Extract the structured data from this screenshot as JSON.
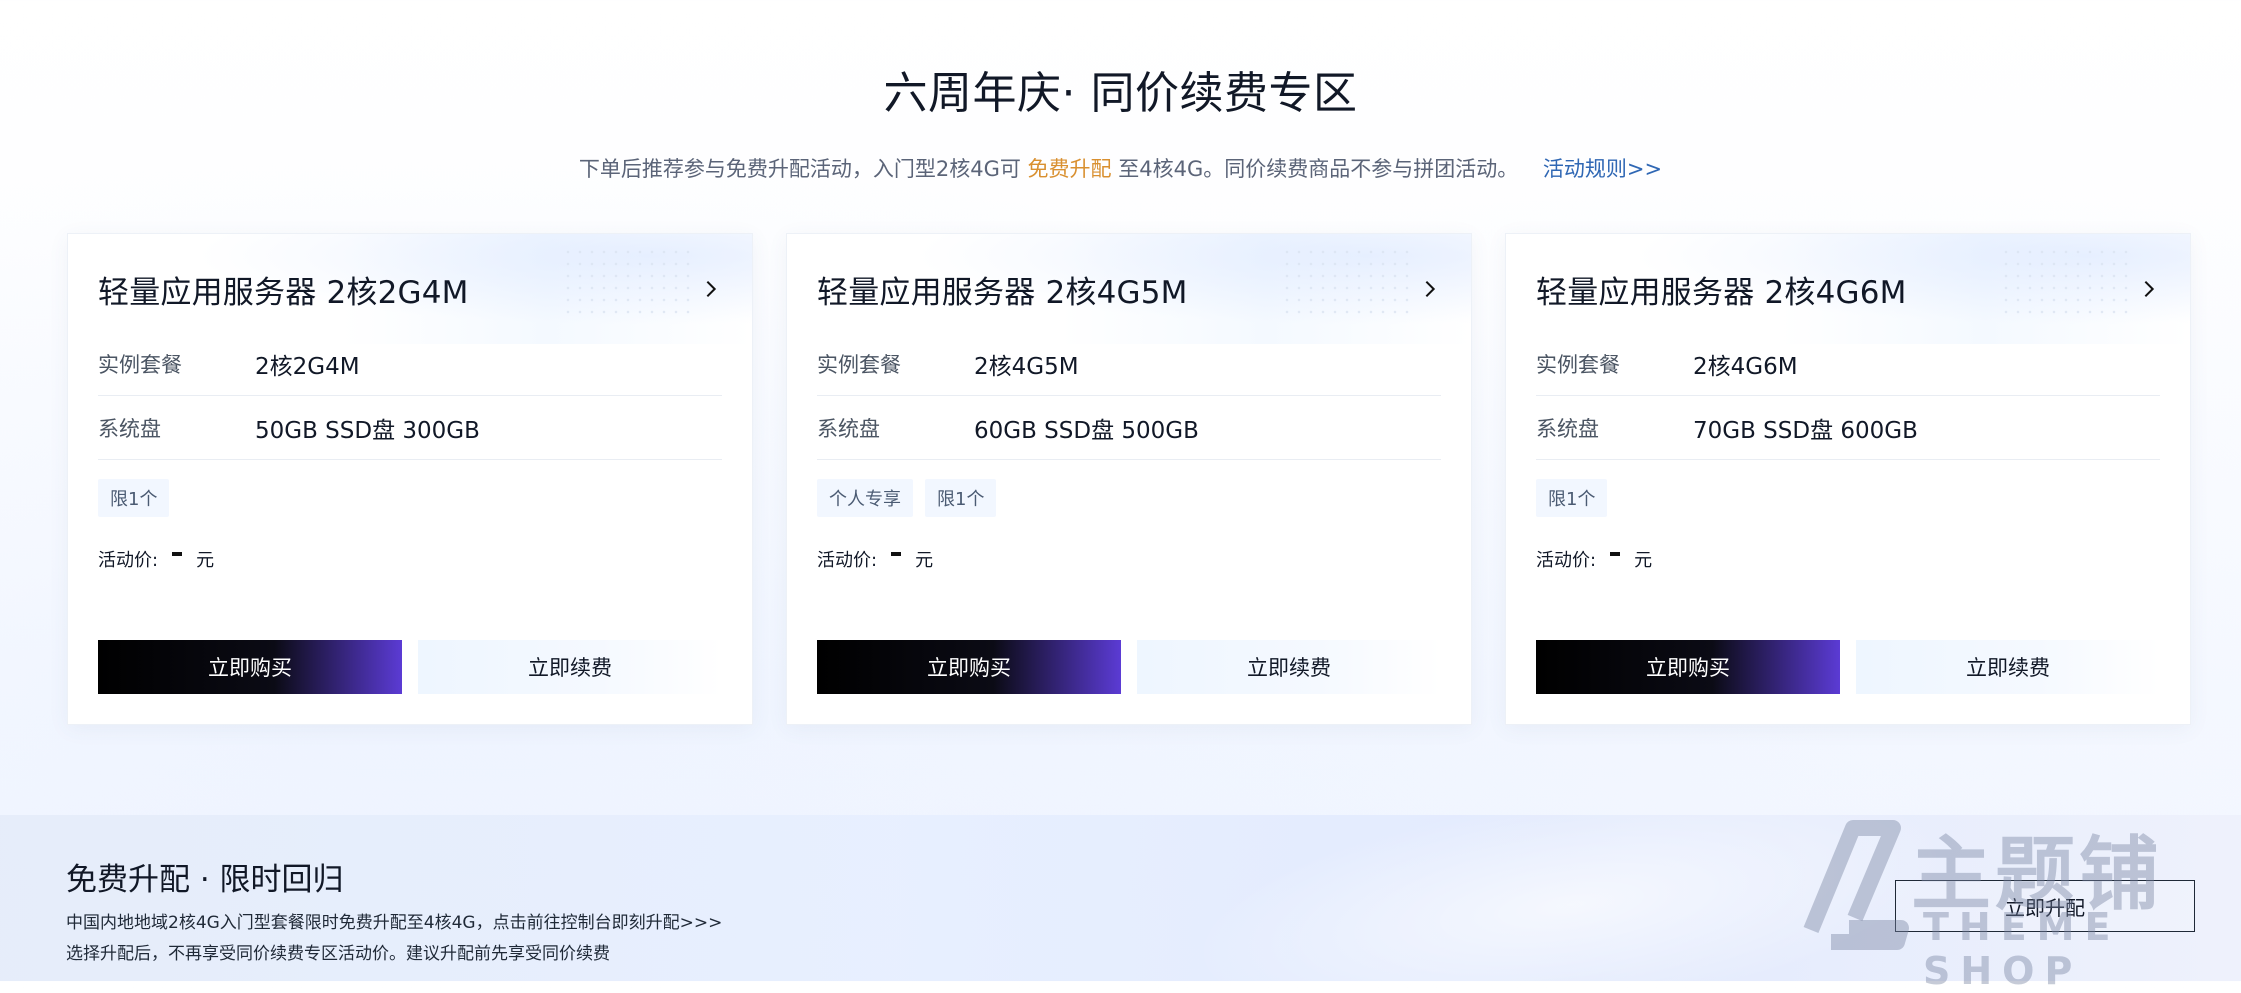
{
  "hero": {
    "title": "六周年庆· 同价续费专区",
    "subtitle_part1": "下单后推荐参与免费升配活动，入门型2核4G可",
    "subtitle_highlight": "免费升配",
    "subtitle_part2": "至4核4G。同价续费商品不参与拼团活动。",
    "rules_link": "活动规则>>"
  },
  "cards": [
    {
      "title": "轻量应用服务器 2核2G4M",
      "rows": [
        {
          "label": "实例套餐",
          "value": "2核2G4M"
        },
        {
          "label": "系统盘",
          "value": "50GB SSD盘 300GB"
        }
      ],
      "tags": [
        "限1个"
      ],
      "price_label": "活动价:",
      "price_unit": "元",
      "buy_label": "立即购买",
      "renew_label": "立即续费"
    },
    {
      "title": "轻量应用服务器 2核4G5M",
      "rows": [
        {
          "label": "实例套餐",
          "value": "2核4G5M"
        },
        {
          "label": "系统盘",
          "value": "60GB SSD盘 500GB"
        }
      ],
      "tags": [
        "个人专享",
        "限1个"
      ],
      "price_label": "活动价:",
      "price_unit": "元",
      "buy_label": "立即购买",
      "renew_label": "立即续费"
    },
    {
      "title": "轻量应用服务器 2核4G6M",
      "rows": [
        {
          "label": "实例套餐",
          "value": "2核4G6M"
        },
        {
          "label": "系统盘",
          "value": "70GB SSD盘 600GB"
        }
      ],
      "tags": [
        "限1个"
      ],
      "price_label": "活动价:",
      "price_unit": "元",
      "buy_label": "立即购买",
      "renew_label": "立即续费"
    }
  ],
  "banner": {
    "title": "免费升配 · 限时回归",
    "line1": "中国内地地域2核4G入门型套餐限时免费升配至4核4G，点击前往控制台即刻升配>>>",
    "line2": "选择升配后，不再享受同价续费专区活动价。建议升配前先享受同价续费",
    "button_label": "立即升配"
  },
  "watermark": {
    "cn": "主题铺",
    "en": "THEME SHOP"
  },
  "colors": {
    "accent_purple": "#5b3bd4",
    "highlight_orange": "#d99030",
    "link_blue": "#2f67b4"
  }
}
